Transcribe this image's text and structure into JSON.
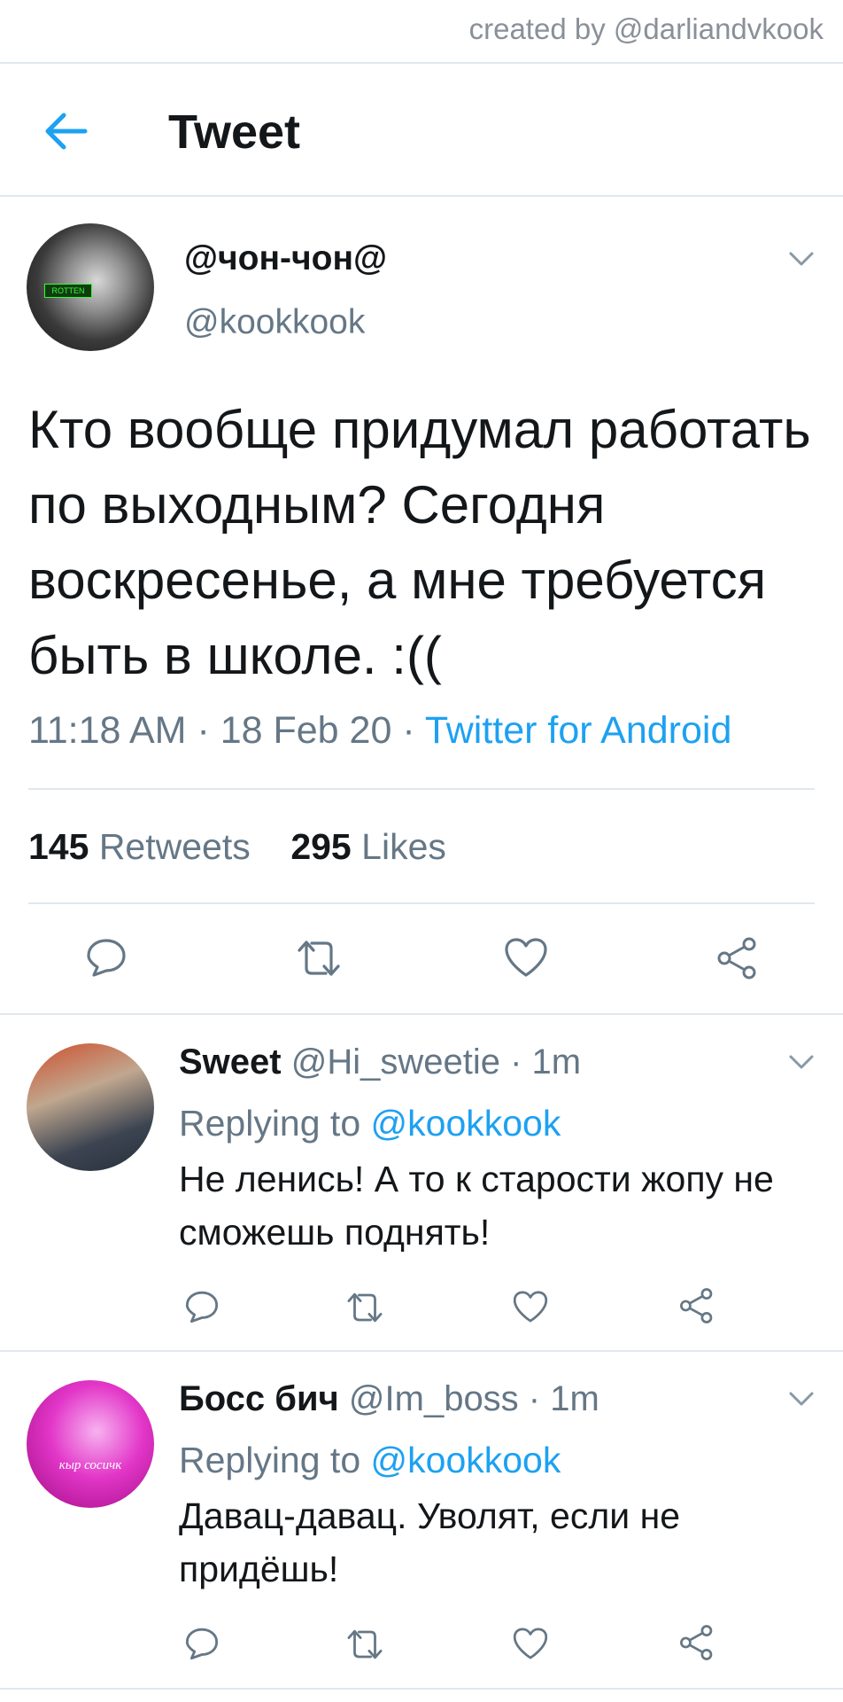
{
  "watermark": "created by @darliandvkook",
  "header": {
    "title": "Tweet"
  },
  "tweet": {
    "display_name": "@чон-чон@",
    "handle": "@kookkook",
    "avatar_badge": "ROTTEN",
    "text": "Кто вообще придумал работать по выходным? Сегодня воскресенье, а мне требуется быть в школе. :((",
    "time": "11:18 AM",
    "sep1": " · ",
    "date": "18 Feb 20",
    "sep2": " · ",
    "source": "Twitter for Android",
    "retweets_count": "145",
    "retweets_label": "Retweets",
    "likes_count": "295",
    "likes_label": "Likes"
  },
  "replies": [
    {
      "display_name": "Sweet",
      "handle": "@Hi_sweetie",
      "time": " · 1m",
      "replying_label": "Replying to ",
      "replying_to": "@kookkook",
      "text": "Не ленись! А то к старости жопу не сможешь поднять!"
    },
    {
      "display_name": "Босс бич",
      "handle": "@Im_boss",
      "time": " · 1m",
      "replying_label": "Replying to ",
      "replying_to": "@kookkook",
      "text": "Давац-давац. Уволят, если не придёшь!",
      "avatar_caption": "кыр сосичк"
    }
  ],
  "icons": [
    "back-arrow-icon",
    "chevron-down-icon",
    "reply-icon",
    "retweet-icon",
    "like-icon",
    "share-icon"
  ],
  "colors": {
    "accent": "#1da1f2",
    "secondary_text": "#657786",
    "divider": "#e1e8ed",
    "icon": "#657786"
  }
}
